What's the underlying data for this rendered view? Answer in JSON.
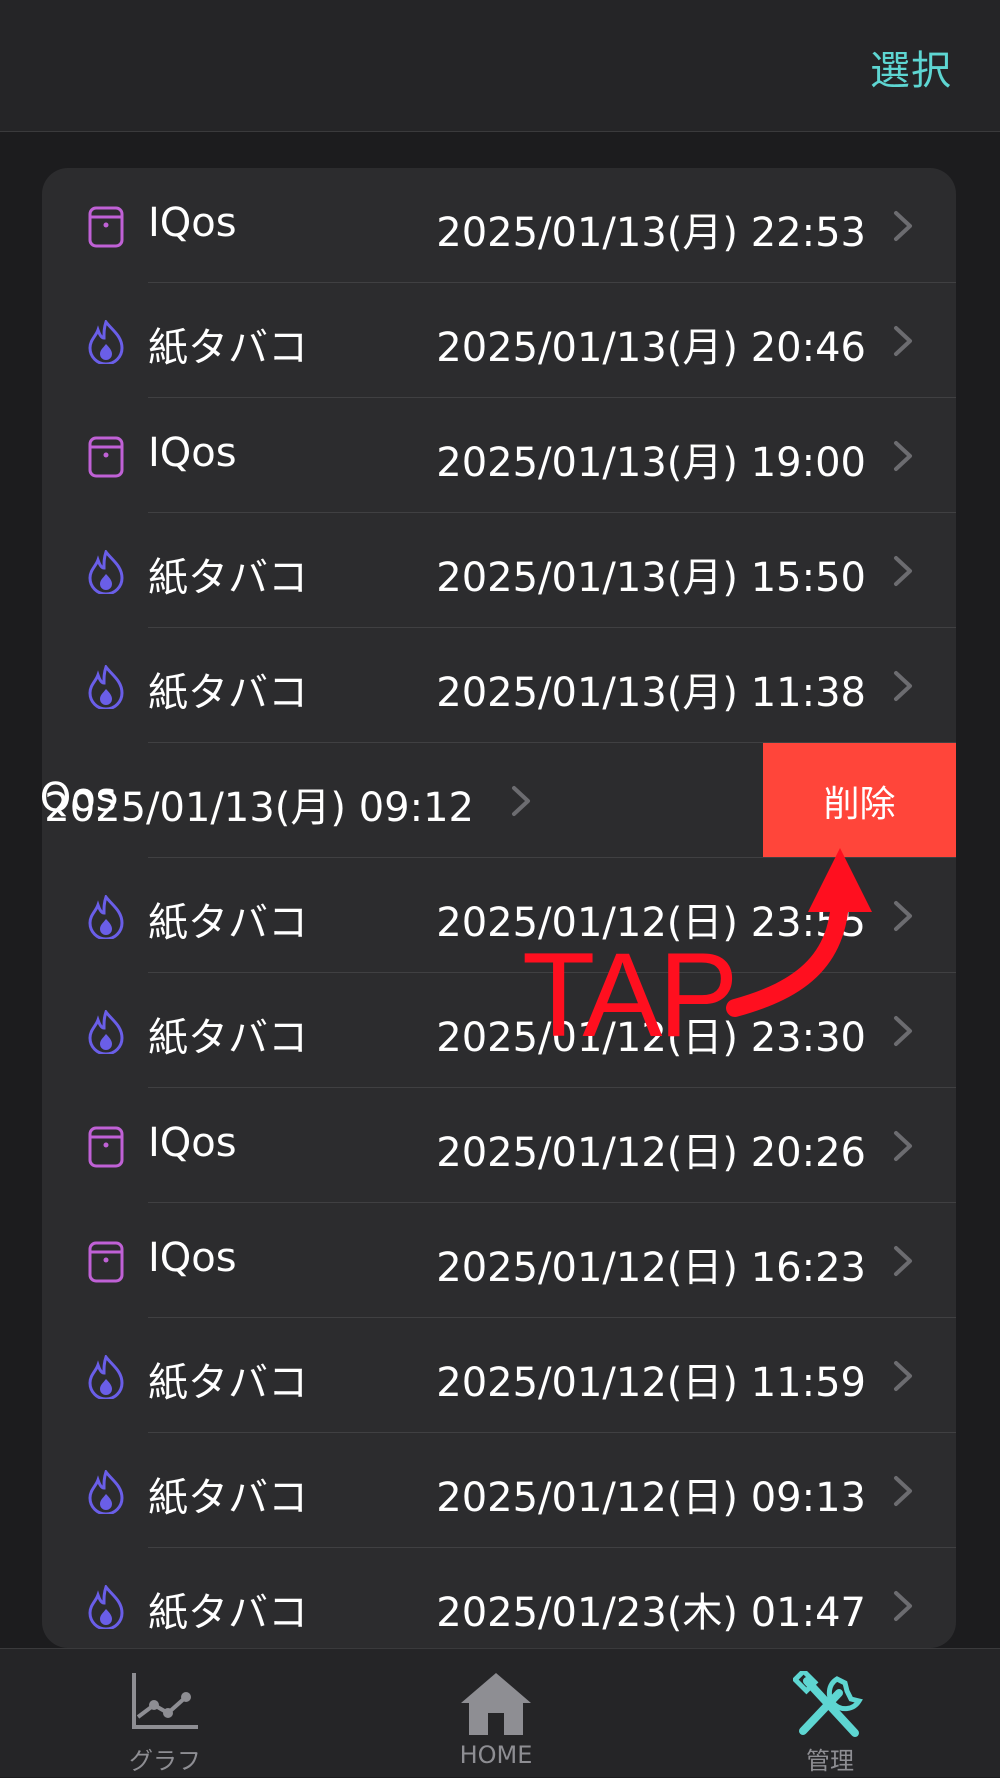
{
  "header": {
    "select_label": "選択"
  },
  "rows": [
    {
      "type": "iqos",
      "label": "IQos",
      "date": "2025/01/13(月) 22:53"
    },
    {
      "type": "cig",
      "label": "紙タバコ",
      "date": "2025/01/13(月) 20:46"
    },
    {
      "type": "iqos",
      "label": "IQos",
      "date": "2025/01/13(月) 19:00"
    },
    {
      "type": "cig",
      "label": "紙タバコ",
      "date": "2025/01/13(月) 15:50"
    },
    {
      "type": "cig",
      "label": "紙タバコ",
      "date": "2025/01/13(月) 11:38"
    },
    {
      "type": "iqos",
      "label": "IQos",
      "date": "2025/01/13(月) 09:12",
      "swiped": true
    },
    {
      "type": "cig",
      "label": "紙タバコ",
      "date": "2025/01/12(日) 23:55"
    },
    {
      "type": "cig",
      "label": "紙タバコ",
      "date": "2025/01/12(日) 23:30"
    },
    {
      "type": "iqos",
      "label": "IQos",
      "date": "2025/01/12(日) 20:26"
    },
    {
      "type": "iqos",
      "label": "IQos",
      "date": "2025/01/12(日) 16:23"
    },
    {
      "type": "cig",
      "label": "紙タバコ",
      "date": "2025/01/12(日) 11:59"
    },
    {
      "type": "cig",
      "label": "紙タバコ",
      "date": "2025/01/12(日) 09:13"
    },
    {
      "type": "cig",
      "label": "紙タバコ",
      "date": "2025/01/23(木) 01:47"
    }
  ],
  "delete_label": "削除",
  "annotation": {
    "label": "TAP",
    "color": "#ff0f1f"
  },
  "tabs": [
    {
      "label": "グラフ",
      "icon": "chart-icon",
      "active": false
    },
    {
      "label": "HOME",
      "icon": "home-icon",
      "active": false
    },
    {
      "label": "管理",
      "icon": "tools-icon",
      "active": true
    }
  ],
  "colors": {
    "accent": "#5ed6d2",
    "iqos_icon": "#c061d6",
    "cigarette_icon": "#6a5ee8",
    "delete": "#ff453a"
  }
}
